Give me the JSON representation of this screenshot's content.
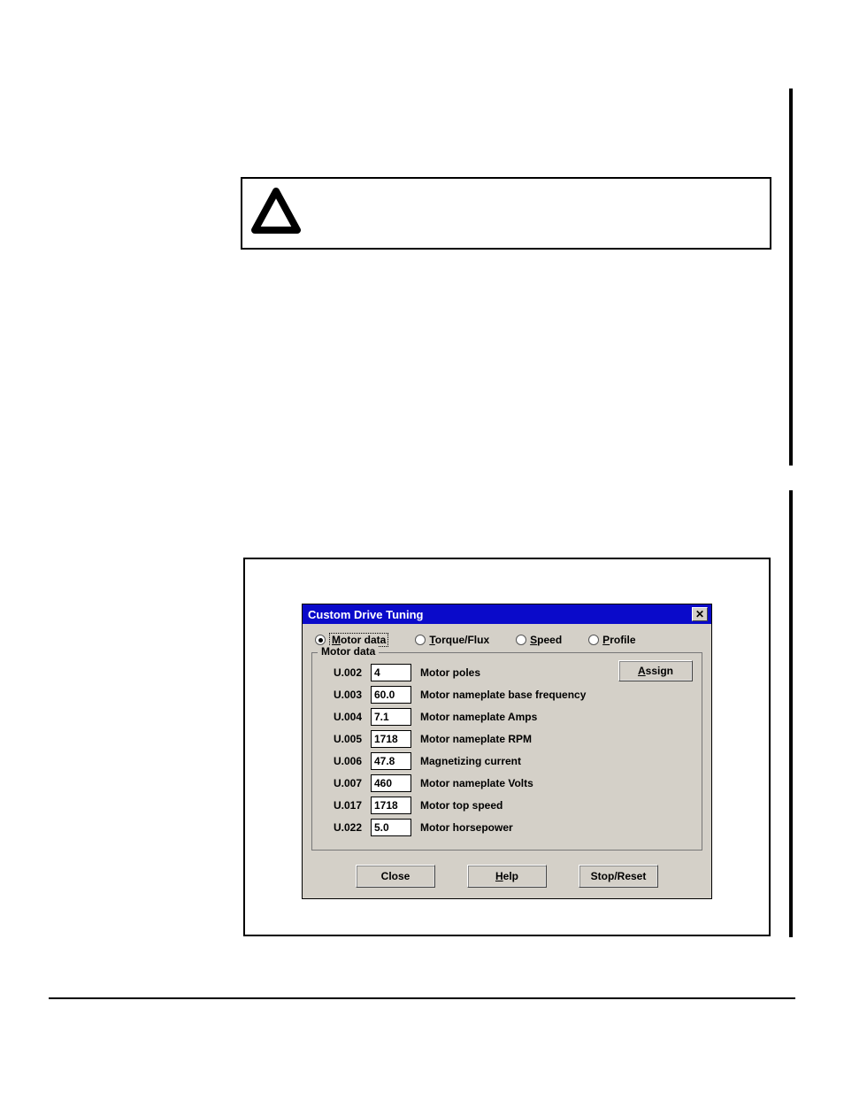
{
  "warning_icon": "triangle",
  "dialog": {
    "title": "Custom Drive Tuning",
    "tabs": [
      {
        "label": "Motor data",
        "underline": "M",
        "selected": true
      },
      {
        "label": "Torque/Flux",
        "underline": "T",
        "selected": false
      },
      {
        "label": "Speed",
        "underline": "S",
        "selected": false
      },
      {
        "label": "Profile",
        "underline": "P",
        "selected": false
      }
    ],
    "group_label": "Motor data",
    "assign_label": "Assign",
    "assign_underline": "A",
    "params": [
      {
        "code": "U.002",
        "value": "4",
        "desc": "Motor poles"
      },
      {
        "code": "U.003",
        "value": "60.0",
        "desc": "Motor nameplate base frequency"
      },
      {
        "code": "U.004",
        "value": "7.1",
        "desc": "Motor nameplate Amps"
      },
      {
        "code": "U.005",
        "value": "1718",
        "desc": "Motor nameplate RPM"
      },
      {
        "code": "U.006",
        "value": "47.8",
        "desc": "Magnetizing current"
      },
      {
        "code": "U.007",
        "value": "460",
        "desc": "Motor nameplate Volts"
      },
      {
        "code": "U.017",
        "value": "1718",
        "desc": "Motor top speed"
      },
      {
        "code": "U.022",
        "value": "5.0",
        "desc": "Motor horsepower"
      }
    ],
    "buttons": {
      "close": "Close",
      "help": "Help",
      "help_underline": "H",
      "stop": "Stop/Reset"
    }
  }
}
